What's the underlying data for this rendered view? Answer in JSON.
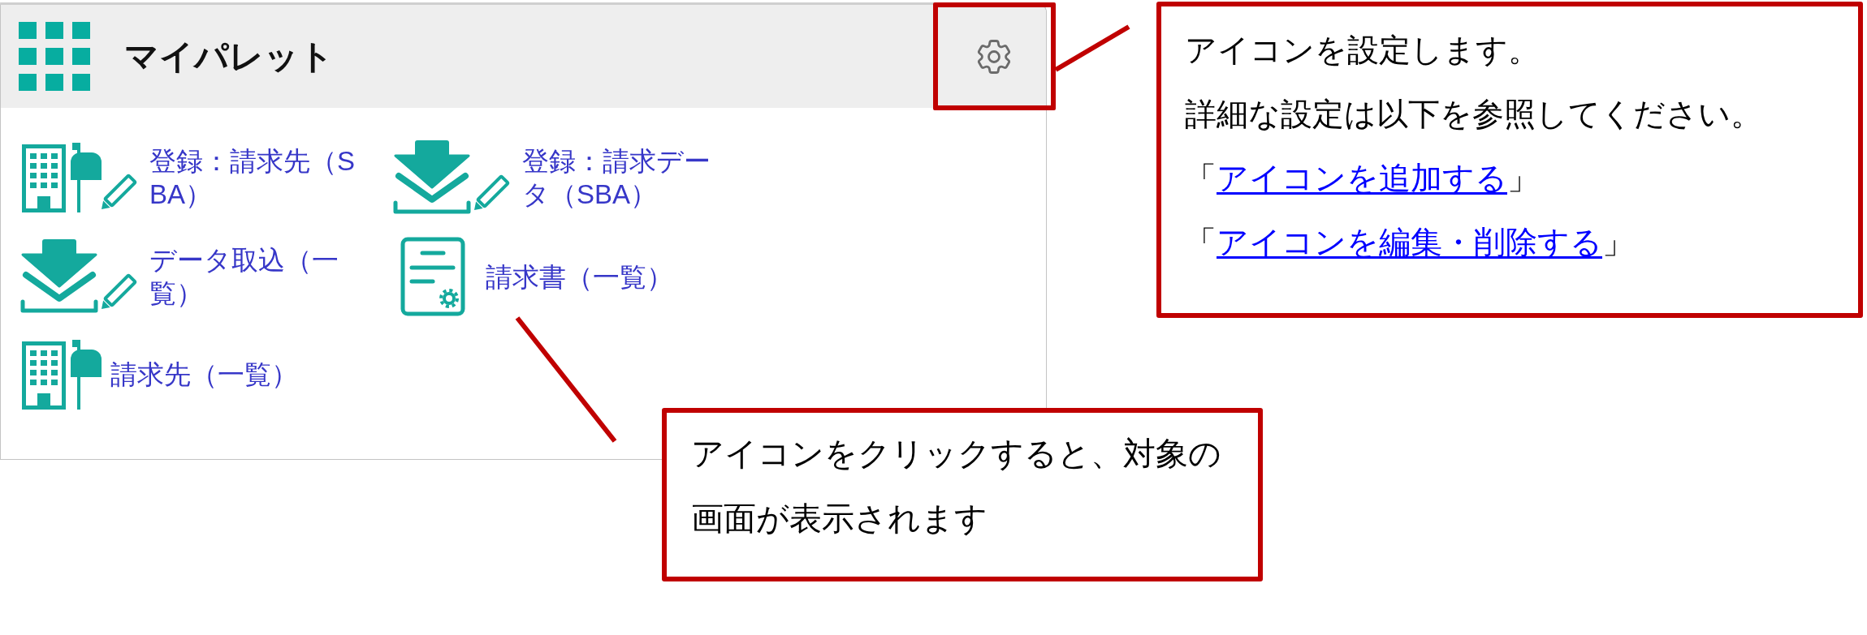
{
  "palette": {
    "title": "マイパレット",
    "items": [
      {
        "kind": "building-edit",
        "label": "登録：請求先（SBA）"
      },
      {
        "kind": "download-edit",
        "label": "登録：請求データ（SBA）"
      },
      {
        "kind": "download-edit",
        "label": "データ取込（一覧）"
      },
      {
        "kind": "document",
        "label": "請求書（一覧）"
      },
      {
        "kind": "building",
        "label": "請求先（一覧）"
      }
    ]
  },
  "callouts": [
    {
      "kind": "settings",
      "lines": [
        {
          "kind": "text",
          "text": "アイコンを設定します。"
        },
        {
          "kind": "text",
          "text": "詳細な設定は以下を参照してください。"
        },
        {
          "kind": "link",
          "before": "「",
          "link": "アイコンを追加する",
          "after": "」"
        },
        {
          "kind": "link",
          "before": "「",
          "link": "アイコンを編集・削除する",
          "after": "」"
        }
      ]
    },
    {
      "kind": "items",
      "lines": [
        {
          "kind": "text",
          "text": "アイコンをクリックすると、対象の画面が表示されます"
        }
      ]
    }
  ]
}
